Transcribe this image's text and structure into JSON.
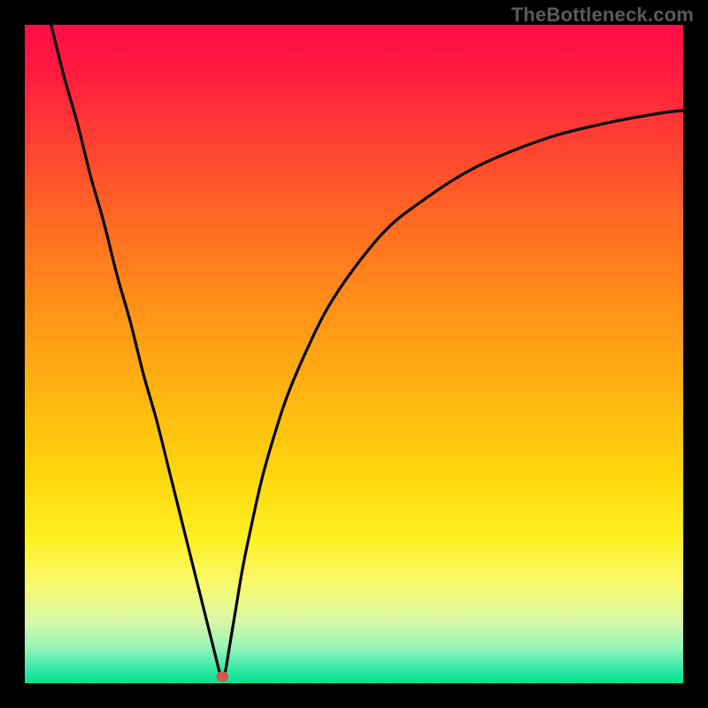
{
  "watermark": {
    "text": "TheBottleneck.com"
  },
  "gradient": {
    "stops": [
      {
        "offset": 0.0,
        "color": "#ff0d46"
      },
      {
        "offset": 0.07,
        "color": "#ff1b3f"
      },
      {
        "offset": 0.18,
        "color": "#ff4132"
      },
      {
        "offset": 0.3,
        "color": "#ff6a23"
      },
      {
        "offset": 0.42,
        "color": "#ff8f19"
      },
      {
        "offset": 0.55,
        "color": "#ffb211"
      },
      {
        "offset": 0.68,
        "color": "#ffd50d"
      },
      {
        "offset": 0.78,
        "color": "#fff022"
      },
      {
        "offset": 0.85,
        "color": "#f9f96e"
      },
      {
        "offset": 0.905,
        "color": "#d8f8a7"
      },
      {
        "offset": 0.945,
        "color": "#99f6b8"
      },
      {
        "offset": 0.975,
        "color": "#3debad"
      },
      {
        "offset": 1.0,
        "color": "#00e38f"
      }
    ]
  },
  "marker": {
    "x_pct": 30.0,
    "y_pct": 99.0,
    "rx": 7,
    "ry": 6,
    "fill": "#d05a52"
  },
  "chart_data": {
    "type": "line",
    "title": "",
    "xlabel": "",
    "ylabel": "",
    "xlim": [
      0,
      100
    ],
    "ylim": [
      0,
      100
    ],
    "series": [
      {
        "name": "bottleneck-curve",
        "x": [
          4,
          6,
          8,
          10,
          12,
          14,
          16,
          18,
          20,
          22,
          24,
          26,
          27,
          28,
          29,
          29.5,
          30,
          30.5,
          31,
          32,
          33,
          34,
          36,
          38,
          40,
          43,
          46,
          50,
          55,
          60,
          66,
          72,
          80,
          88,
          96,
          100
        ],
        "y": [
          100,
          92,
          85,
          77,
          70,
          62,
          55,
          47,
          40,
          32,
          24,
          16,
          12,
          8,
          4,
          2,
          0.5,
          2,
          5,
          11,
          17,
          22,
          31,
          38,
          44,
          51,
          57,
          63,
          69,
          73,
          77,
          80,
          83,
          85,
          86.5,
          87
        ]
      }
    ],
    "annotations": [
      {
        "type": "marker",
        "x": 30,
        "y": 1,
        "label": "optimal-point"
      }
    ]
  }
}
